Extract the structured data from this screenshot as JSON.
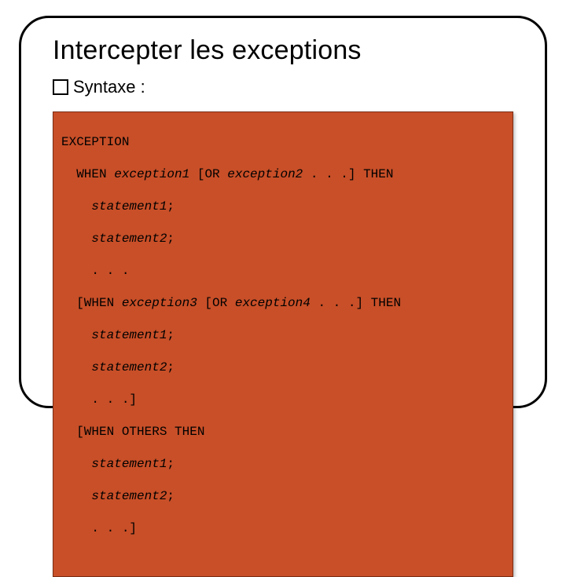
{
  "title": "Intercepter les exceptions",
  "bullet": "Syntaxe :",
  "code": {
    "l1": "EXCEPTION",
    "l2a": "WHEN ",
    "l2b": "exception1",
    "l2c": " [OR ",
    "l2d": "exception2",
    "l2e": " . . .] THEN",
    "l3a": "statement1",
    "l3b": ";",
    "l4a": "statement2",
    "l4b": ";",
    "l5": ". . .",
    "l6a": "[WHEN ",
    "l6b": "exception3",
    "l6c": " [OR ",
    "l6d": "exception4",
    "l6e": " . . .] THEN",
    "l7a": "statement1",
    "l7b": ";",
    "l8a": "statement2",
    "l8b": ";",
    "l9": ". . .]",
    "l10": "[WHEN OTHERS THEN",
    "l11a": "statement1",
    "l11b": ";",
    "l12a": "statement2",
    "l12b": ";",
    "l13": ". . .]"
  }
}
